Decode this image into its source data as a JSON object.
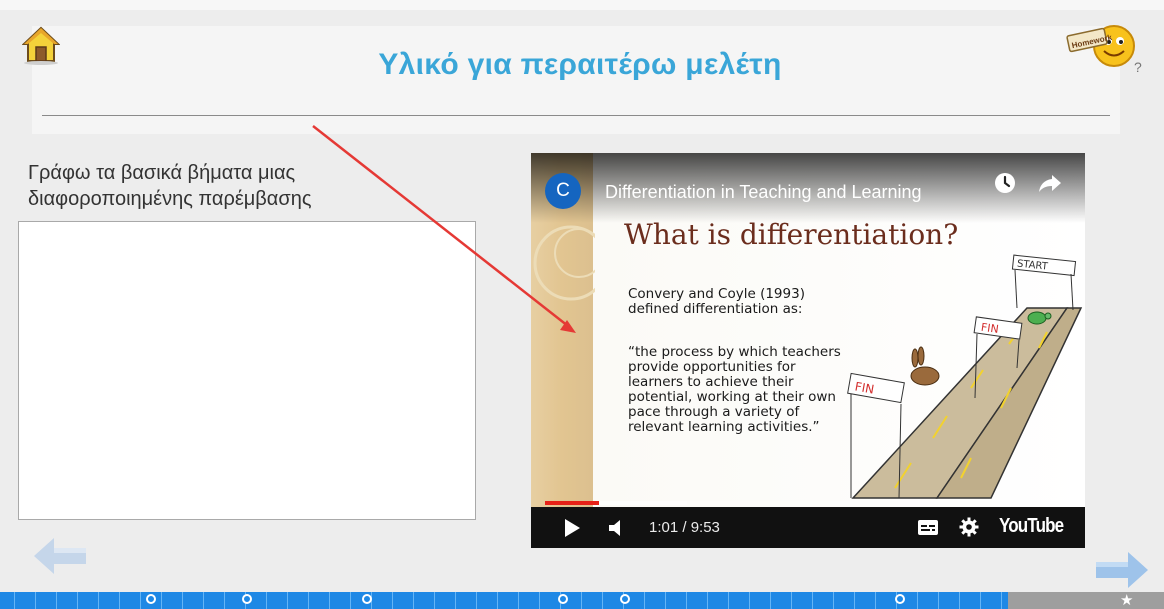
{
  "header": {
    "title": "Υλικό για περαιτέρω μελέτη",
    "homework_sign": "Homework"
  },
  "exercise": {
    "prompt_line1": "Γράφω τα βασικά βήματα μιας",
    "prompt_line2": "διαφοροποιημένης παρέμβασης",
    "answer_value": ""
  },
  "video": {
    "channel_initial": "C",
    "title": "Differentiation in Teaching and Learning",
    "slide_heading": "What is differentiation?",
    "slide_text_1": "Convery and Coyle (1993) defined differentiation as:",
    "slide_text_2": "“the process by which teachers provide opportunities for learners to achieve their potential, working at their own pace through a variety of relevant learning activities.”",
    "drawing_labels": {
      "start": "START",
      "fin_top": "FIN",
      "fin_bottom": "FIN"
    },
    "current_time": "1:01",
    "duration": "9:53",
    "time_display": "1:01 / 9:53",
    "played_fraction": 0.103,
    "buffered_fraction": 0.27,
    "logo": "YouTube",
    "colors": {
      "progress": "#e62117",
      "avatar": "#1565c0"
    }
  },
  "annotation": {
    "arrow_color": "#e53935"
  },
  "progress_bar": {
    "color": "#1e88e5",
    "markers": 8,
    "icons": [
      "home-icon",
      "homework-icon",
      "arrow-left-icon",
      "arrow-right-icon",
      "star-icon"
    ]
  }
}
